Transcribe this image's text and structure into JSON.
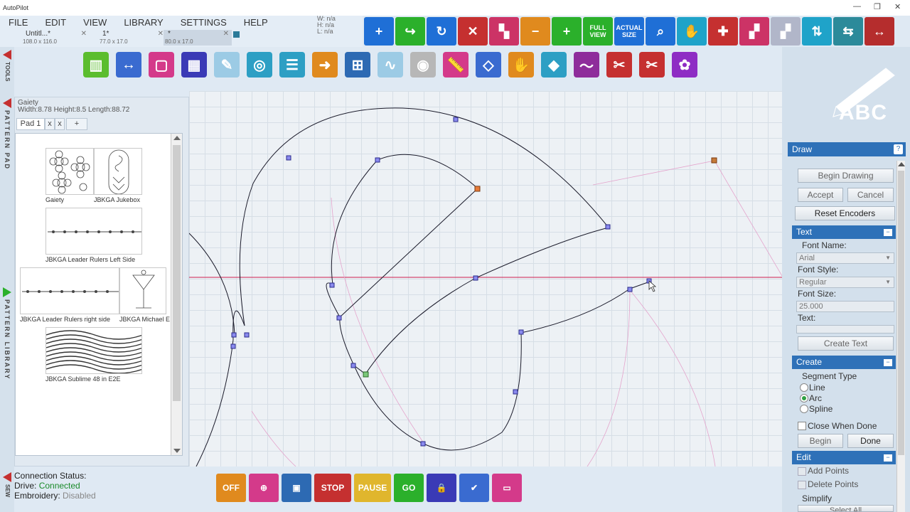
{
  "app": {
    "title": "AutoPilot"
  },
  "menu": [
    "FILE",
    "EDIT",
    "VIEW",
    "LIBRARY",
    "SETTINGS",
    "HELP"
  ],
  "doc_tabs": [
    {
      "name": "Untitl...*",
      "size": "108.0 x 116.0"
    },
    {
      "name": "1*",
      "size": "77.0 x 17.0"
    },
    {
      "name": "*",
      "size": "80.0 x 17.0"
    }
  ],
  "wh_readout": {
    "w": "W:  n/a",
    "h": "H:  n/a",
    "l": "L:  n/a"
  },
  "top_toolbar": [
    {
      "name": "add",
      "label": "+",
      "color": "#1f6fd6"
    },
    {
      "name": "go-arrow",
      "label": "↪",
      "color": "#2bb02b"
    },
    {
      "name": "redo",
      "label": "↻",
      "color": "#1f6fd6"
    },
    {
      "name": "delete",
      "label": "✕",
      "color": "#c53030"
    },
    {
      "name": "layers",
      "label": "▚",
      "color": "#cc3366"
    },
    {
      "name": "zoom-out",
      "label": "−",
      "color": "#e08a1e"
    },
    {
      "name": "zoom-in",
      "label": "+",
      "color": "#2bb02b"
    },
    {
      "name": "full-view",
      "label": "FULL VIEW",
      "color": "#2bb02b",
      "small": true
    },
    {
      "name": "actual-size",
      "label": "ACTUAL SIZE",
      "color": "#1f6fd6",
      "small": true
    },
    {
      "name": "search",
      "label": "⌕",
      "color": "#1f6fd6"
    },
    {
      "name": "pan",
      "label": "✋",
      "color": "#1fa3c9"
    },
    {
      "name": "crosshair",
      "label": "✚",
      "color": "#c53030"
    },
    {
      "name": "steps",
      "label": "▞",
      "color": "#cc3366"
    },
    {
      "name": "steps-alt",
      "label": "▞",
      "color": "#b1b6c9"
    },
    {
      "name": "align",
      "label": "⇅",
      "color": "#1fa3c9"
    },
    {
      "name": "bounce",
      "label": "⇆",
      "color": "#2c8a9a"
    },
    {
      "name": "stretch",
      "label": "↔",
      "color": "#b52d2d"
    }
  ],
  "tool_row": [
    {
      "name": "chart-tool",
      "label": "▥",
      "color": "#5bbd2e"
    },
    {
      "name": "move-tool",
      "label": "↔",
      "color": "#3a6bd0"
    },
    {
      "name": "rect-tool",
      "label": "▢",
      "color": "#d43a8a"
    },
    {
      "name": "grid-tool",
      "label": "▦",
      "color": "#3a3ab6"
    },
    {
      "name": "pen-tool",
      "label": "✎",
      "color": "#9ccbe5"
    },
    {
      "name": "spiral-tool",
      "label": "◎",
      "color": "#2d9fc4"
    },
    {
      "name": "list-tool",
      "label": "☰",
      "color": "#2d9fc4"
    },
    {
      "name": "arrow-tool",
      "label": "➜",
      "color": "#e08a1e"
    },
    {
      "name": "grid-select-tool",
      "label": "⊞",
      "color": "#2d6ab3"
    },
    {
      "name": "curve-tool",
      "label": "∿",
      "color": "#9ccbe5"
    },
    {
      "name": "circle-tool",
      "label": "◉",
      "color": "#b7b7b7"
    },
    {
      "name": "ruler-tool",
      "label": "📏",
      "color": "#d43a8a"
    },
    {
      "name": "eraser-tool",
      "label": "◇",
      "color": "#3a6bd0"
    },
    {
      "name": "hand-tool",
      "label": "✋",
      "color": "#e08a1e"
    },
    {
      "name": "pin-tool",
      "label": "◆",
      "color": "#2d9fc4"
    },
    {
      "name": "wave-tool",
      "label": "〜",
      "color": "#8e2d9b"
    },
    {
      "name": "scissors-tool",
      "label": "✂",
      "color": "#c53030"
    },
    {
      "name": "cut-tool",
      "label": "✂",
      "color": "#c53030"
    },
    {
      "name": "flower-tool",
      "label": "✿",
      "color": "#8e2dc4"
    }
  ],
  "vtabs": {
    "tools": "TOOLS",
    "pattern_pad": "PATTERN PAD",
    "pattern_library": "PATTERN LIBRARY",
    "sew": "SEW"
  },
  "pad": {
    "pattern_name": "Gaiety",
    "dims": "Width:8.78 Height:8.5 Length:88.72",
    "tab_label": "Pad 1",
    "tab_close": "x",
    "tab_close2": "x",
    "tab_add": "+",
    "patterns": [
      "Gaiety",
      "JBKGA Jukebox",
      "JBKGA Leader Rulers Left Side",
      "JBKGA Leader Rulers right side",
      "JBKGA Michael E",
      "JBKGA Sublime 48 in E2E"
    ]
  },
  "right_panel": {
    "logo_text": "ABC",
    "draw_header": "Draw",
    "help": "?",
    "begin_drawing": "Begin Drawing",
    "accept": "Accept",
    "cancel": "Cancel",
    "reset_encoders": "Reset Encoders",
    "text_header": "Text",
    "font_name_label": "Font Name:",
    "font_name_value": "Arial",
    "font_style_label": "Font Style:",
    "font_style_value": "Regular",
    "font_size_label": "Font Size:",
    "font_size_value": "25.000",
    "text_label": "Text:",
    "text_value": "",
    "create_text": "Create Text",
    "create_header": "Create",
    "segment_type_label": "Segment Type",
    "segment_options": [
      "Line",
      "Arc",
      "Spline"
    ],
    "segment_selected": "Arc",
    "close_when_done": "Close When Done",
    "begin": "Begin",
    "done": "Done",
    "edit_header": "Edit",
    "add_points": "Add Points",
    "delete_points": "Delete Points",
    "simplify": "Simplify",
    "select_all": "Select All",
    "collapse": "−"
  },
  "status": {
    "connection_label": "Connection Status:",
    "drive_label": "Drive:",
    "drive_value": "Connected",
    "embroidery_label": "Embroidery:",
    "embroidery_value": "Disabled"
  },
  "bottom_toolbar": [
    {
      "name": "off",
      "label": "OFF",
      "color": "#e08a1e"
    },
    {
      "name": "target",
      "label": "⊕",
      "color": "#d43a8a"
    },
    {
      "name": "frame",
      "label": "▣",
      "color": "#2d6ab3"
    },
    {
      "name": "stop",
      "label": "STOP",
      "color": "#c53030",
      "wide": true
    },
    {
      "name": "pause",
      "label": "PAUSE",
      "color": "#e0b62d",
      "wide": true
    },
    {
      "name": "go",
      "label": "GO",
      "color": "#2bb02b"
    },
    {
      "name": "lock",
      "label": "🔒",
      "color": "#3a3ab6"
    },
    {
      "name": "check",
      "label": "✔",
      "color": "#3a6bd0"
    },
    {
      "name": "window",
      "label": "▭",
      "color": "#d43a8a"
    }
  ],
  "colors": {
    "accent_blue": "#2e71b8",
    "path_line": "#1a1a2a",
    "guide_red": "#d02050",
    "ghost_pink": "#e0a0c8"
  }
}
